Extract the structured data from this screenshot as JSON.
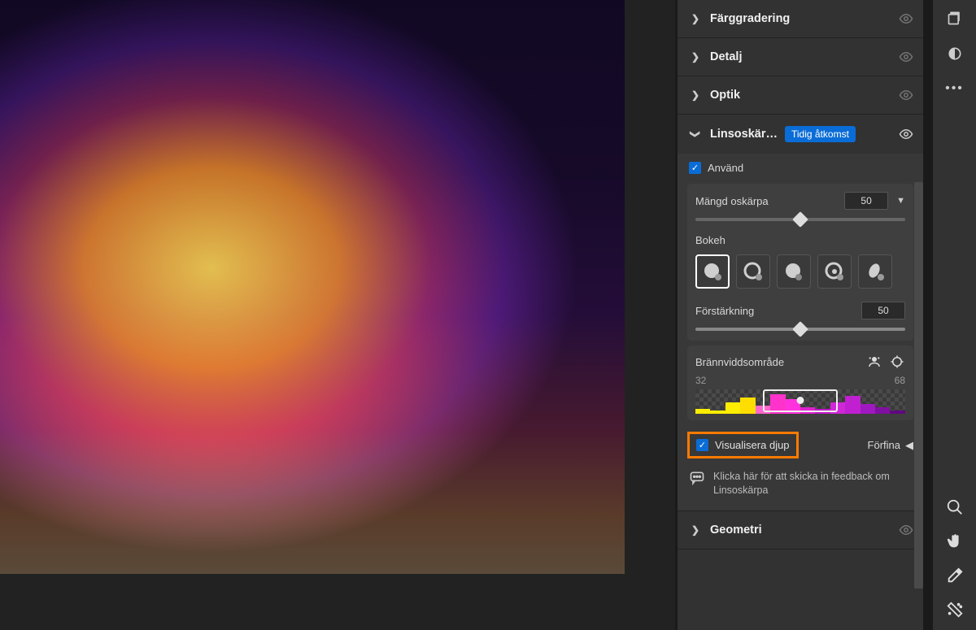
{
  "sections": {
    "farggradering": "Färggradering",
    "detalj": "Detalj",
    "optik": "Optik",
    "linsoskarpa": "Linsoskär…",
    "geometri": "Geometri"
  },
  "badge_early_access": "Tidig åtkomst",
  "lens_blur": {
    "apply_label": "Använd",
    "amount_label": "Mängd oskärpa",
    "amount_value": "50",
    "bokeh_label": "Bokeh",
    "gain_label": "Förstärkning",
    "gain_value": "50",
    "focal_label": "Brännviddsområde",
    "focal_min": "32",
    "focal_max": "68",
    "visualize_label": "Visualisera djup",
    "refine_label": "Förfina",
    "feedback_text": "Klicka här för att skicka in feedback om Linsoskärpa"
  }
}
